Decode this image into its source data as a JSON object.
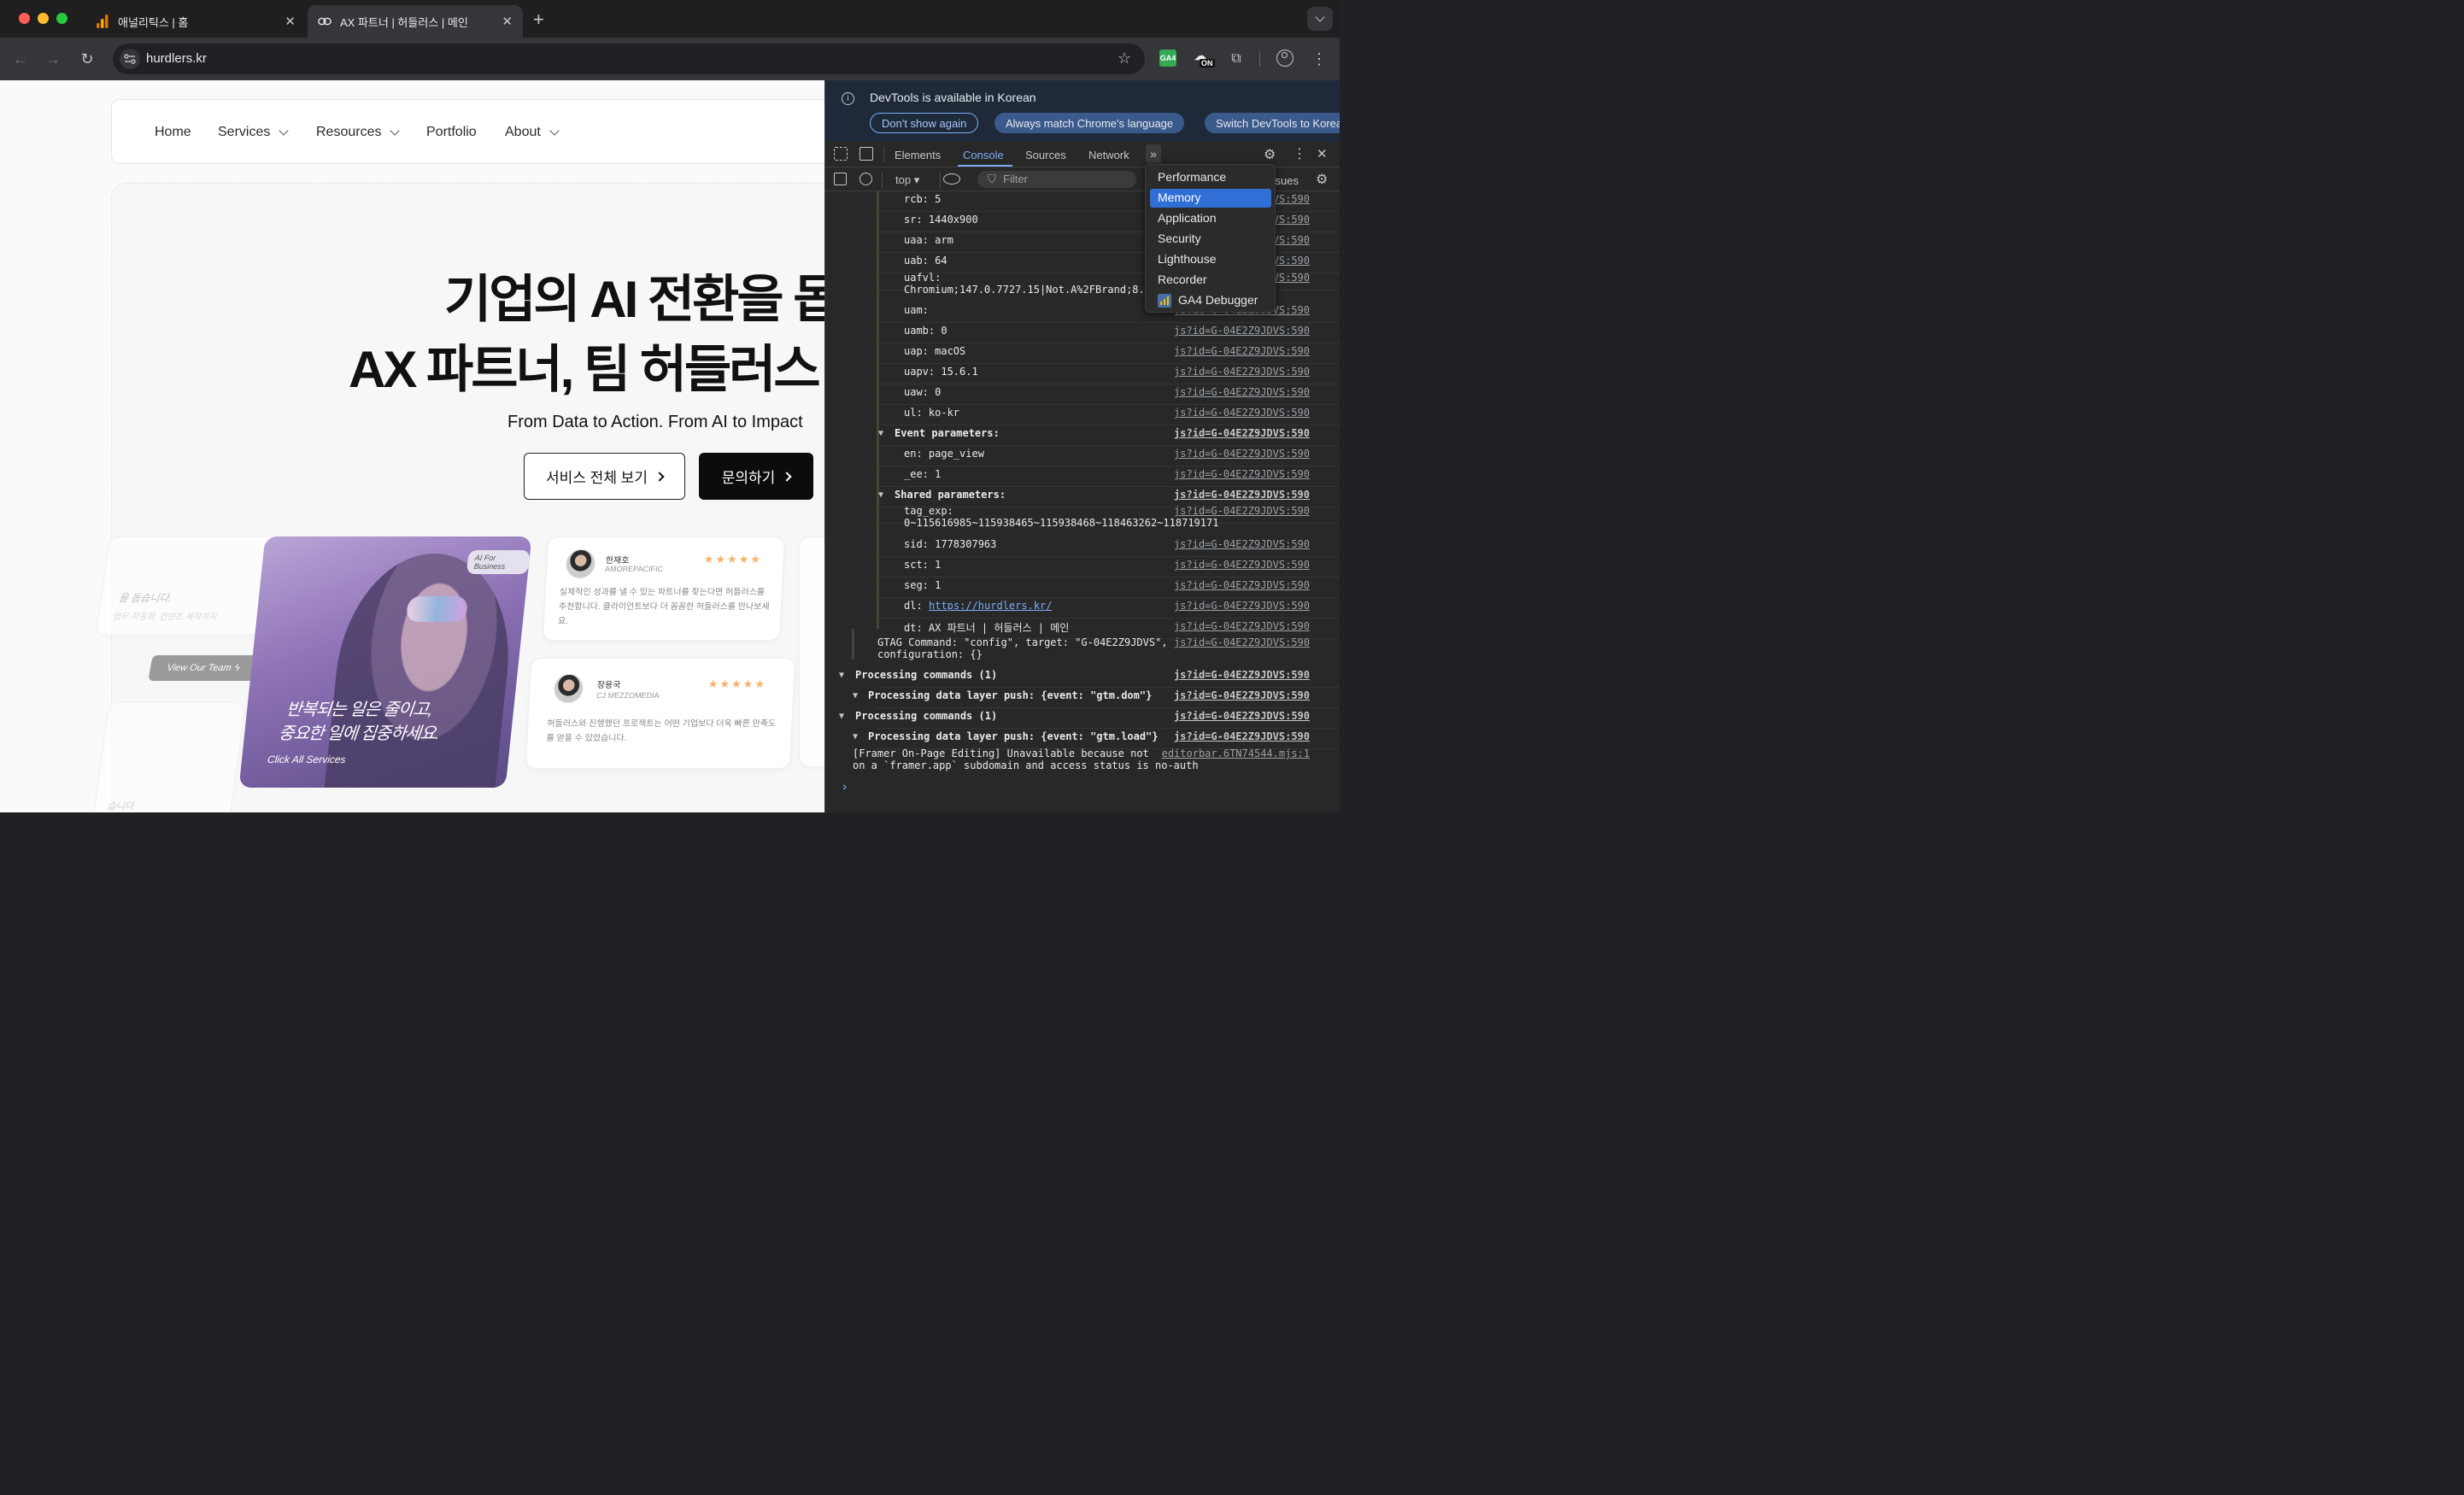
{
  "browser": {
    "tabs": [
      {
        "title": "애널리틱스 | 홈",
        "icon": "analytics-icon",
        "active": false
      },
      {
        "title": "AX 파트너 | 허들러스 | 메인",
        "icon": "link-icon",
        "active": true
      }
    ],
    "new_tab_label": "+",
    "url": "hurdlers.kr",
    "extensions": [
      "ga4-extension-icon",
      "on-extension-icon",
      "puzzle-extensions-icon"
    ]
  },
  "site": {
    "nav": [
      {
        "label": "Home",
        "has_dropdown": false
      },
      {
        "label": "Services",
        "has_dropdown": true
      },
      {
        "label": "Resources",
        "has_dropdown": true
      },
      {
        "label": "Portfolio",
        "has_dropdown": false
      },
      {
        "label": "About",
        "has_dropdown": true
      }
    ],
    "hero": {
      "line1": "기업의 AI 전환을 돕",
      "line2": "AX 파트너, 팀 허들러스",
      "subtitle": "From Data to Action. From AI to Impact",
      "btn_services": "서비스 전체 보기",
      "btn_contact": "문의하기"
    },
    "cards": {
      "left_text1": "을 돕습니다.",
      "left_text2": "업무 자동화, 컨텐츠 제작까지",
      "view_team": "View Our Team",
      "left_bottom": "습니다.",
      "promo_badge": "AI For Business",
      "promo_line1": "반복되는 일은 줄이고,",
      "promo_line2": "중요한 일에 집중하세요.",
      "promo_link": "Click All Services",
      "testimonials": [
        {
          "name": "한재호",
          "company": "AMOREPACIFIC",
          "stars": "★★★★★",
          "quote": "실제적인 성과를 낼 수 있는 파트너를 찾는다면 허들러스를 추천합니다. 클라이언트보다 더 꼼꼼한 허들러스를 만나보세요."
        },
        {
          "name": "장용국",
          "company": "CJ MEZZOMEDIA",
          "stars": "★★★★★",
          "quote": "허들러스와 진행했던 프로젝트는 어떤 기업보다 더욱 빠른 만족도를 얻을 수 있었습니다."
        }
      ]
    }
  },
  "devtools": {
    "infobar": {
      "message": "DevTools is available in Korean",
      "btn_dismiss": "Don't show again",
      "btn_match": "Always match Chrome's language",
      "btn_switch": "Switch DevTools to Korean"
    },
    "tabs": [
      "Elements",
      "Console",
      "Sources",
      "Network"
    ],
    "active_tab": "Console",
    "context": "top",
    "filter_placeholder": "Filter",
    "issues_label": "ssues",
    "overflow_menu": [
      "Performance",
      "Memory",
      "Application",
      "Security",
      "Lighthouse",
      "Recorder",
      "GA4 Debugger"
    ],
    "overflow_selected": "Memory",
    "console": {
      "lines": [
        {
          "text": "rcb: 5",
          "src": "JDVS:590"
        },
        {
          "text": "sr: 1440x900",
          "src": "JDVS:590"
        },
        {
          "text": "uaa: arm",
          "src": "JDVS:590"
        },
        {
          "text": "uab: 64",
          "src": "JDVS:590"
        },
        {
          "text": "uafvl:",
          "text2": "Chromium;147.0.7727.15|Not.A%2FBrand;8.0",
          "src": "JDVS:590"
        },
        {
          "text": "uam:",
          "src": "js?id=G-04E2Z9JDVS:590"
        },
        {
          "text": "uamb: 0",
          "src": "js?id=G-04E2Z9JDVS:590"
        },
        {
          "text": "uap: macOS",
          "src": "js?id=G-04E2Z9JDVS:590"
        },
        {
          "text": "uapv: 15.6.1",
          "src": "js?id=G-04E2Z9JDVS:590"
        },
        {
          "text": "uaw: 0",
          "src": "js?id=G-04E2Z9JDVS:590"
        },
        {
          "text": "ul: ko-kr",
          "src": "js?id=G-04E2Z9JDVS:590"
        },
        {
          "text": "Event parameters:",
          "src": "js?id=G-04E2Z9JDVS:590"
        },
        {
          "text": "en: page_view",
          "src": "js?id=G-04E2Z9JDVS:590"
        },
        {
          "text": "_ee: 1",
          "src": "js?id=G-04E2Z9JDVS:590"
        },
        {
          "text": "Shared parameters:",
          "src": "js?id=G-04E2Z9JDVS:590"
        },
        {
          "text": "tag_exp:",
          "text2": "0~115616985~115938465~115938468~118463262~118719171",
          "src": "js?id=G-04E2Z9JDVS:590"
        },
        {
          "text": "sid: 1778307963",
          "src": "js?id=G-04E2Z9JDVS:590"
        },
        {
          "text": "sct: 1",
          "src": "js?id=G-04E2Z9JDVS:590"
        },
        {
          "text": "seg: 1",
          "src": "js?id=G-04E2Z9JDVS:590"
        },
        {
          "text": "dl: ",
          "link": "https://hurdlers.kr/",
          "src": "js?id=G-04E2Z9JDVS:590"
        },
        {
          "text": "dt: AX 파트너 | 허들러스 | 메인",
          "src": "js?id=G-04E2Z9JDVS:590"
        },
        {
          "text": "GTAG Command: \"config\", target: \"G-04E2Z9JDVS\",",
          "text2": "configuration: {}",
          "src": "js?id=G-04E2Z9JDVS:590"
        },
        {
          "text": "Processing commands (1)",
          "src": "js?id=G-04E2Z9JDVS:590"
        },
        {
          "text": "Processing data layer push: {event: \"gtm.dom\"}",
          "src": "js?id=G-04E2Z9JDVS:590"
        },
        {
          "text": "Processing commands (1)",
          "src": "js?id=G-04E2Z9JDVS:590"
        },
        {
          "text": "Processing data layer push: {event: \"gtm.load\"}",
          "src": "js?id=G-04E2Z9JDVS:590"
        },
        {
          "text": "[Framer On-Page Editing] Unavailable because not",
          "text2": "on a `framer.app` subdomain and access status is no-auth",
          "src": "editorbar.6TN74544.mjs:1"
        }
      ],
      "prompt": "›"
    }
  },
  "colors": {
    "accent_blue": "#2f6fd6",
    "console_tab_underline": "#7cacf8",
    "link_blue": "#7cacf8"
  }
}
